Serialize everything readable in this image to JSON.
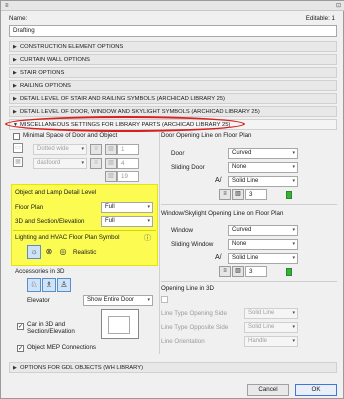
{
  "header": {
    "name_label": "Name:",
    "editable": "Editable: 1",
    "name_value": "Drafting"
  },
  "sections": [
    "CONSTRUCTION ELEMENT OPTIONS",
    "CURTAIN WALL OPTIONS",
    "STAIR OPTIONS",
    "RAILING OPTIONS",
    "DETAIL LEVEL OF STAIR AND RAILING SYMBOLS (ARCHICAD LIBRARY 25)",
    "DETAIL LEVEL OF DOOR, WINDOW AND SKYLIGHT SYMBOLS (ARCHICAD LIBRARY 25)",
    "MISCELLANEOUS SETTINGS FOR LIBRARY PARTS (ARCHICAD LIBRARY 25)"
  ],
  "left": {
    "min_space_label": "Minimal Space of Door and Object",
    "line_type_value": "Dotted wide",
    "pen_value": "dasfoord",
    "num1": "1",
    "num2": "4",
    "num3": "19",
    "object_lamp_title": "Object and Lamp Detail Level",
    "floor_plan_label": "Floor Plan",
    "floor_plan_value": "Full",
    "section_label": "3D and Section/Elevation",
    "section_value": "Full",
    "lighting_title": "Lighting and HVAC Floor Plan Symbol",
    "realistic_label": "Realistic",
    "accessories_label": "Accessories in 3D",
    "elevator_label": "Elevator",
    "elevator_value": "Show Entire Door",
    "car_label": "Car in 3D and Section/Elevation",
    "mep_label": "Object MEP Connections"
  },
  "right": {
    "door_open_title": "Door Opening Line on Floor Plan",
    "door_label": "Door",
    "door_value": "Curved",
    "sliding_door_label": "Sliding Door",
    "sliding_door_value": "None",
    "solid_line_1": "Solid Line",
    "num_a": "3",
    "window_title": "Window/Skylight Opening Line on Floor Plan",
    "window_label": "Window",
    "window_value": "Curved",
    "sliding_window_label": "Sliding Window",
    "sliding_window_value": "None",
    "solid_line_2": "Solid Line",
    "num_b": "3",
    "opening_3d_title": "Opening Line in 3D",
    "lt_side_label": "Line Type Opening Side",
    "lt_side_value": "Solid Line",
    "lt_opp_label": "Line Type Opposite Side",
    "lt_opp_value": "Solid Line",
    "line_orient_label": "Line Orientation",
    "line_orient_value": "Handle"
  },
  "footer_section": "OPTIONS FOR GDL OBJECTS (WH LIBRARY)",
  "buttons": {
    "cancel": "Cancel",
    "ok": "OK"
  }
}
